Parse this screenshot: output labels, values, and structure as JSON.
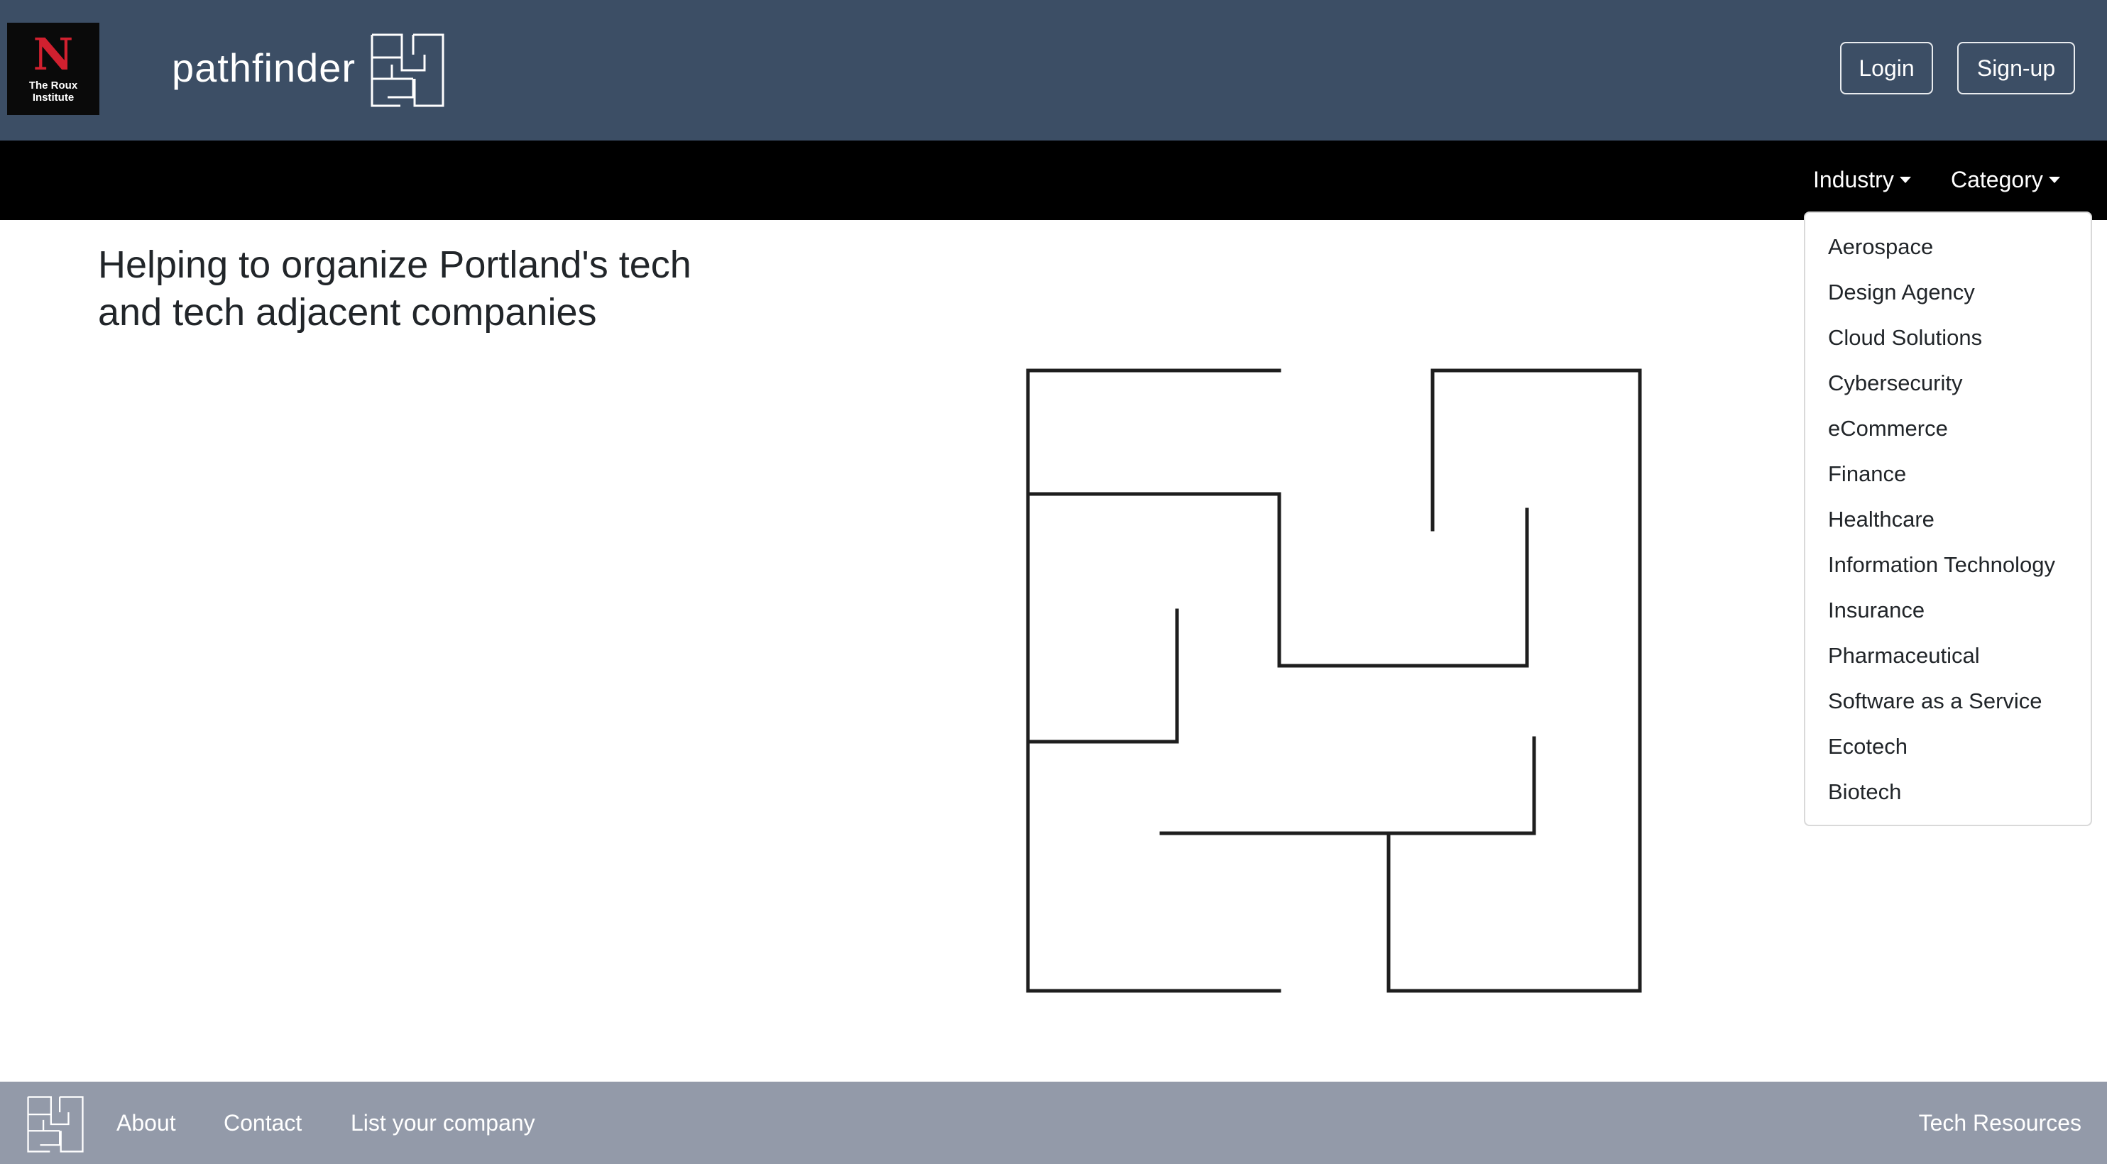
{
  "header": {
    "org_logo_text_line1": "The Roux",
    "org_logo_text_line2": "Institute",
    "org_logo_letter": "N",
    "brand_name": "pathfinder",
    "login_label": "Login",
    "signup_label": "Sign-up",
    "background_color": "#3c4e65"
  },
  "nav": {
    "industry_label": "Industry",
    "category_label": "Category",
    "background_color": "#000000"
  },
  "dropdown": {
    "open_menu": "Industry",
    "items": [
      "Aerospace",
      "Design Agency",
      "Cloud Solutions",
      "Cybersecurity",
      "eCommerce",
      "Finance",
      "Healthcare",
      "Information Technology",
      "Insurance",
      "Pharmaceutical",
      "Software as a Service",
      "Ecotech",
      "Biotech"
    ]
  },
  "main": {
    "title": "Helping to organize Portland's tech and tech adjacent companies",
    "illustration": "maze-icon"
  },
  "footer": {
    "about_label": "About",
    "contact_label": "Contact",
    "list_company_label": "List your company",
    "tech_resources_label": "Tech Resources",
    "background_color": "#939aa9"
  }
}
